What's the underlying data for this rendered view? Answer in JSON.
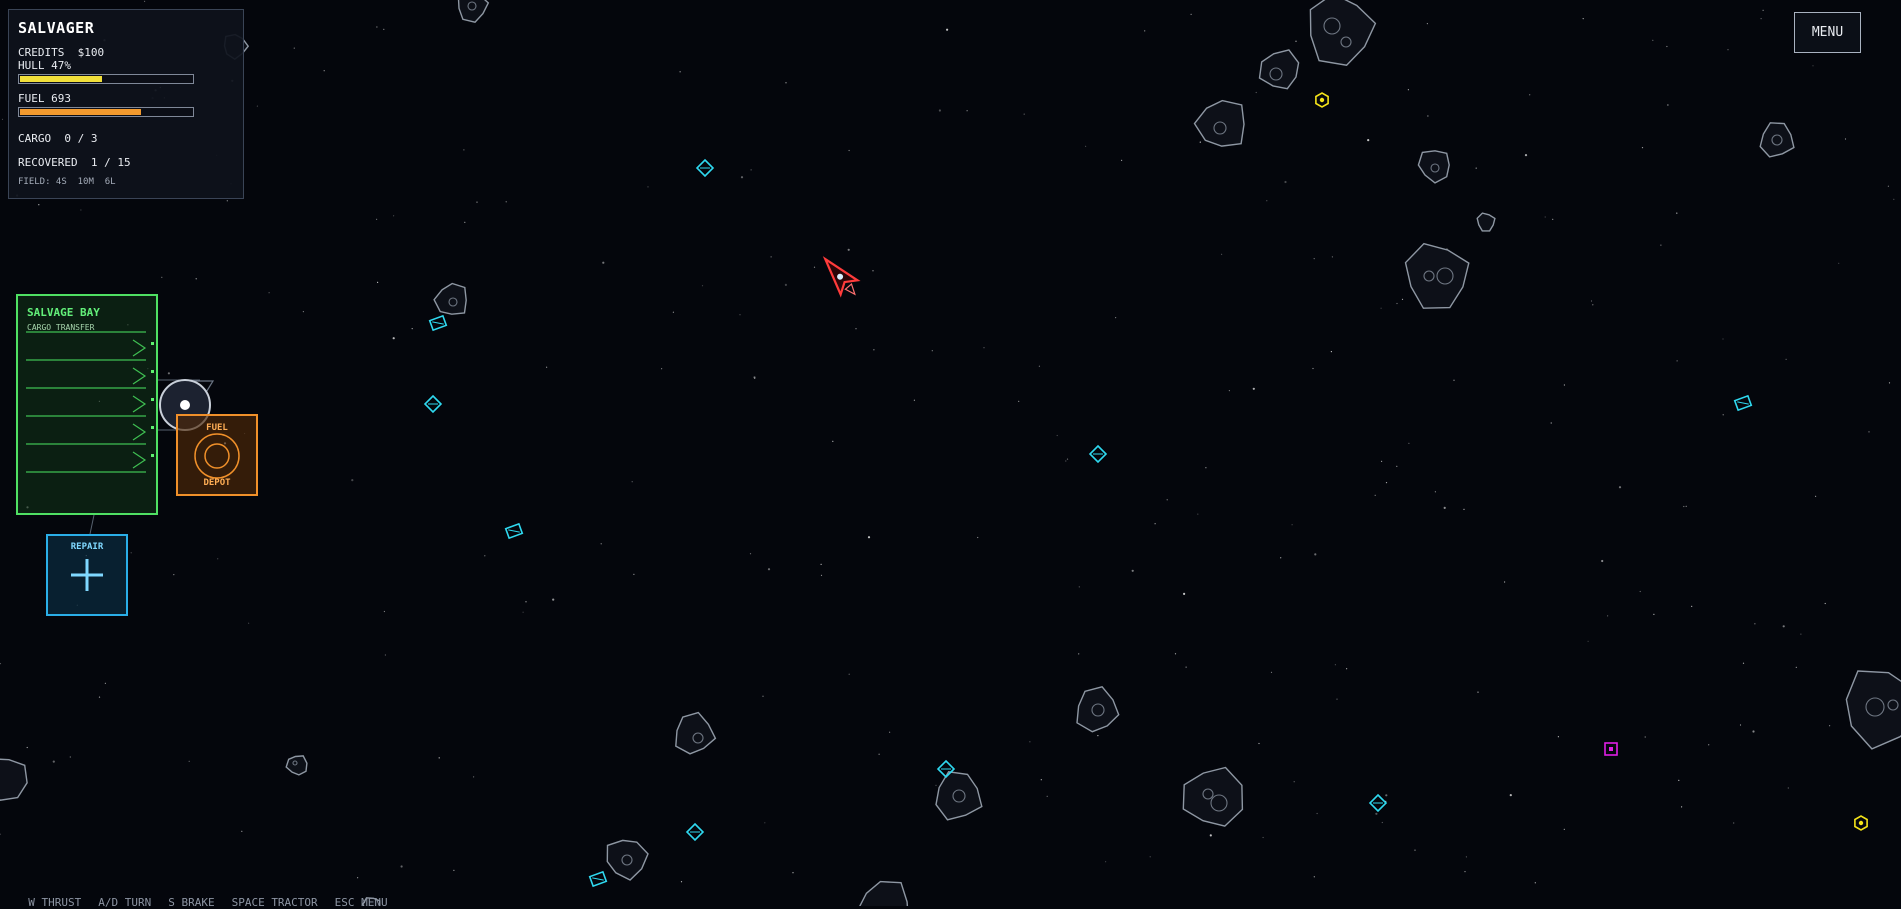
{
  "hud": {
    "title": "SALVAGER",
    "credits_line": "CREDITS  $100",
    "hull_label": "HULL 47%",
    "hull_level": 0.47,
    "fuel_label": "FUEL 693",
    "fuel_level": 0.693,
    "cargo_line": "CARGO  0 / 3",
    "recovered_line": "RECOVERED  1 / 15",
    "field_line": "FIELD: 4S  10M  6L"
  },
  "menu": {
    "label": "MENU"
  },
  "stations": {
    "salvage_bay": {
      "title": "SALVAGE BAY",
      "subtitle": "CARGO TRANSFER"
    },
    "fuel_depot": {
      "top_label": "FUEL",
      "bottom_label": "DEPOT"
    },
    "repair": {
      "label": "REPAIR"
    }
  },
  "controls": [
    "W THRUST",
    "A/D TURN",
    "S BRAKE",
    "SPACE TRACTOR",
    "ESC MENU"
  ],
  "colors": {
    "background": "#04060c",
    "asteroid": "#8e97a3",
    "salvage_cyan": "#2fd9f0",
    "salvage_yellow": "#f5e419",
    "salvage_magenta": "#e01ee6",
    "player_ship": "#ff3b3b",
    "salvage_bay": "#4fe063",
    "fuel_depot": "#f0902a",
    "repair": "#2aaee8"
  },
  "icons": {
    "player": "ship-icon",
    "asteroid": "asteroid-icon",
    "salvage": "salvage-crate-icon",
    "repair": "plus-icon"
  }
}
